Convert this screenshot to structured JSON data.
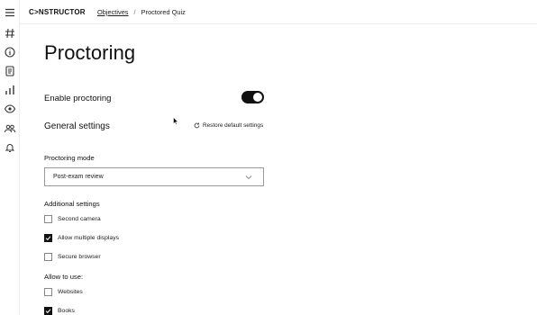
{
  "app": {
    "logo_text": "C>NSTRUCTOR"
  },
  "breadcrumb": {
    "link": "Objectives",
    "separator": "/",
    "current": "Proctored Quiz"
  },
  "sidebar": {
    "icons": [
      "menu-icon",
      "hash-icon",
      "info-icon",
      "document-icon",
      "bar-chart-icon",
      "eye-icon",
      "users-icon",
      "bell-icon"
    ]
  },
  "page": {
    "title": "Proctoring",
    "enable_label": "Enable proctoring",
    "enable_on": true,
    "general_title": "General settings",
    "restore_label": "Restore default settings",
    "mode_label": "Proctoring mode",
    "mode_value": "Post-exam review",
    "additional_title": "Additional settings",
    "additional": [
      {
        "label": "Second camera",
        "checked": false
      },
      {
        "label": "Allow multiple displays",
        "checked": true
      },
      {
        "label": "Secure browser",
        "checked": false
      }
    ],
    "allow_title": "Allow to use:",
    "allow": [
      {
        "label": "Websites",
        "checked": false
      },
      {
        "label": "Books",
        "checked": true
      }
    ]
  }
}
